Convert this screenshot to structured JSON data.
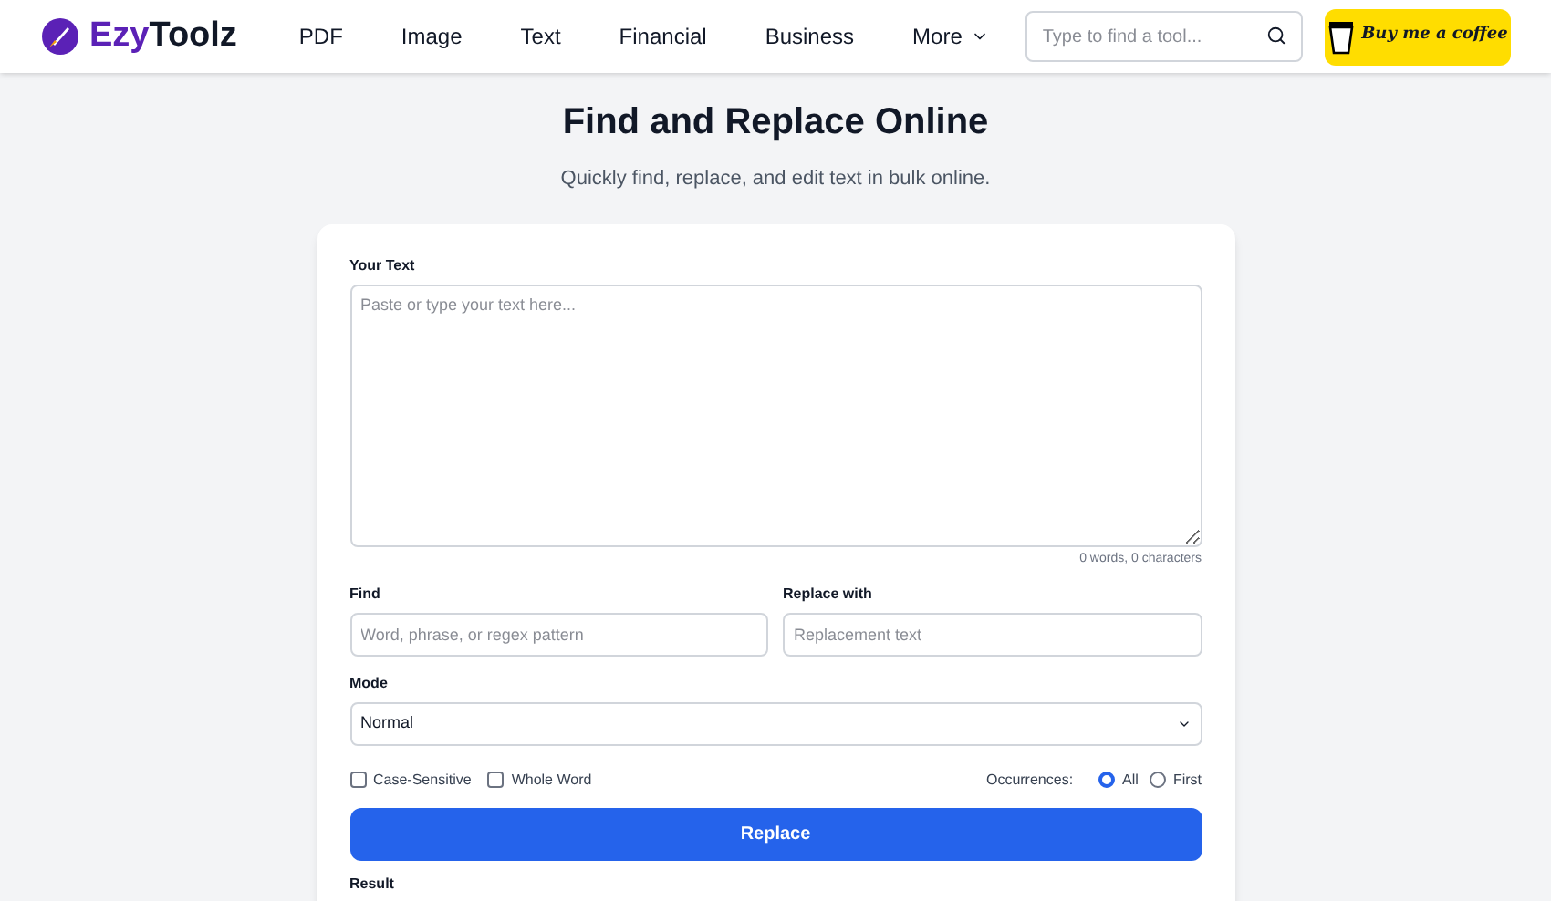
{
  "header": {
    "logo": "EzyToolz",
    "nav": [
      {
        "label": "PDF",
        "kind": "link"
      },
      {
        "label": "Image",
        "kind": "link"
      },
      {
        "label": "Text",
        "kind": "link"
      },
      {
        "label": "Financial",
        "kind": "link"
      },
      {
        "label": "Business",
        "kind": "link"
      },
      {
        "label": "More",
        "kind": "dropdown"
      }
    ],
    "search": {
      "placeholder": "Type to find a tool..."
    },
    "coffee_button": "Buy me a coffee"
  },
  "title": "Find and Replace Online",
  "subtitle": "Quickly find, replace, and edit text in bulk online.",
  "form": {
    "text_label": "Your Text",
    "text_placeholder": "Paste or type your text here...",
    "counter": "0 words, 0 characters",
    "find_label": "Find",
    "find_placeholder": "Word, phrase, or regex pattern",
    "replace_label": "Replace with",
    "replace_placeholder": "Replacement text",
    "mode_label": "Mode",
    "mode_value": "Normal",
    "options": [
      {
        "label": "Case-Sensitive",
        "checked": false
      },
      {
        "label": "Whole Word",
        "checked": false
      }
    ],
    "occurrences_label": "Occurrences:",
    "occurrences": [
      {
        "label": "All",
        "selected": true
      },
      {
        "label": "First",
        "selected": false
      }
    ],
    "button": "Replace",
    "result_label": "Result"
  }
}
